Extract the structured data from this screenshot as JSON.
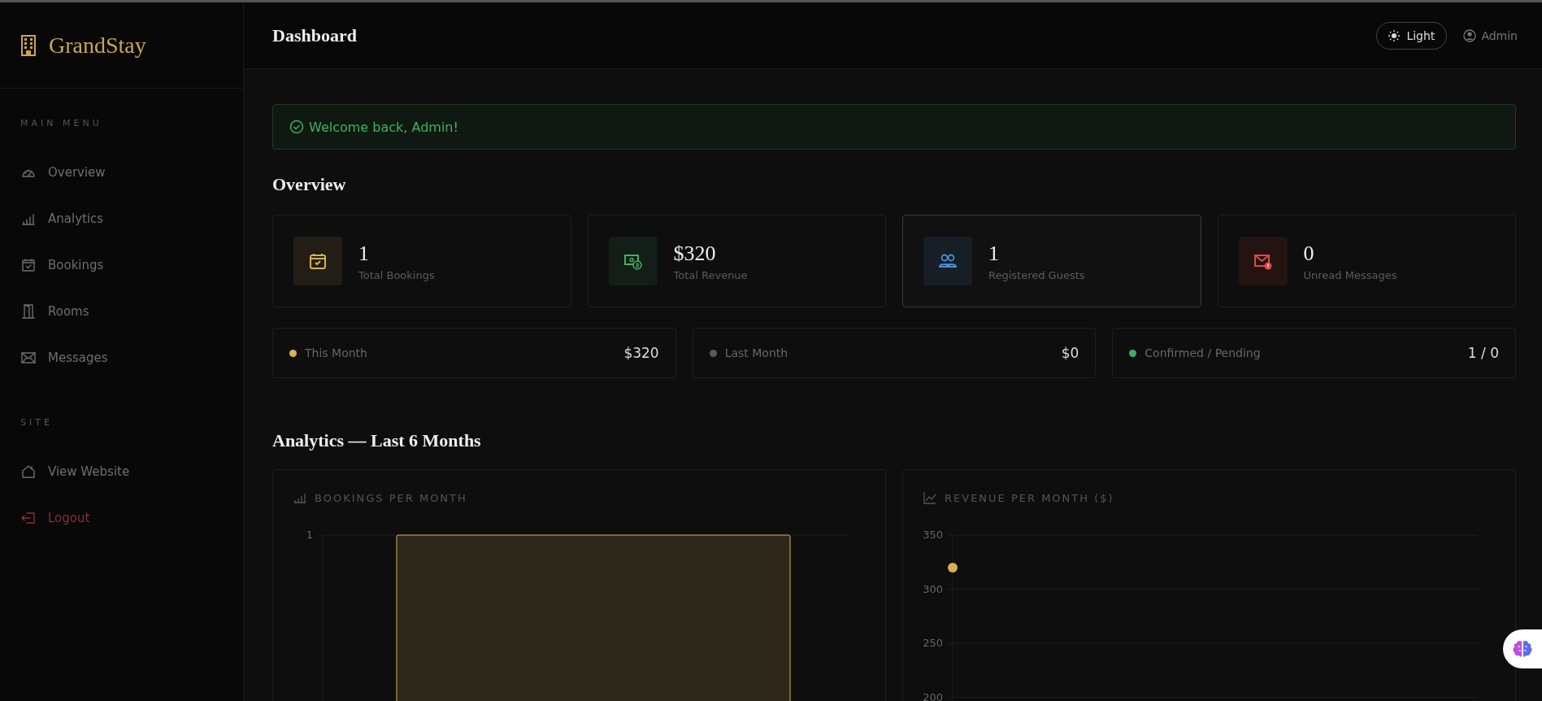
{
  "sidebar": {
    "brand": "GrandStay",
    "sections": [
      {
        "title": "MAIN MENU",
        "items": [
          {
            "label": "Overview",
            "kind": "link"
          },
          {
            "label": "Analytics",
            "kind": "link"
          },
          {
            "label": "Bookings",
            "kind": "link"
          },
          {
            "label": "Rooms",
            "kind": "link"
          },
          {
            "label": "Messages",
            "kind": "link"
          }
        ]
      },
      {
        "title": "SITE",
        "items": [
          {
            "label": "View Website",
            "kind": "link"
          },
          {
            "label": "Logout",
            "kind": "danger"
          }
        ]
      }
    ]
  },
  "header": {
    "title": "Dashboard",
    "theme_button": "Light",
    "user": "Admin"
  },
  "alert": {
    "kind": "success",
    "text": "Welcome back, Admin!"
  },
  "overview": {
    "title": "Overview",
    "stats": [
      {
        "value": "1",
        "label": "Total Bookings",
        "color": "#d4b255",
        "hovered": false
      },
      {
        "value": "$320",
        "label": "Total Revenue",
        "color": "#3fb15f",
        "hovered": false
      },
      {
        "value": "1",
        "label": "Registered Guests",
        "color": "#4a90d9",
        "hovered": true
      },
      {
        "value": "0",
        "label": "Unread Messages",
        "color": "#e04a3f",
        "hovered": false
      }
    ],
    "summary": [
      {
        "label": "This Month",
        "value": "$320",
        "color": "#d4b255"
      },
      {
        "label": "Last Month",
        "value": "$0",
        "color": "#5a5a5a"
      },
      {
        "label": "Confirmed / Pending",
        "value": "1 / 0",
        "color": "#3fb15f"
      }
    ]
  },
  "analytics": {
    "title": "Analytics — Last 6 Months",
    "charts": [
      {
        "title": "BOOKINGS PER MONTH",
        "kind": "bar",
        "y_tick_labels": [
          "1"
        ]
      },
      {
        "title": "REVENUE PER MONTH ($)",
        "kind": "line",
        "y_tick_labels": [
          "350",
          "300",
          "250",
          "200"
        ]
      }
    ]
  }
}
